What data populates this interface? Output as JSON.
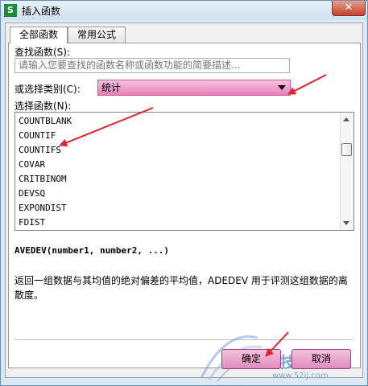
{
  "window": {
    "title": "插入函数",
    "app_icon": "S",
    "close": "✕"
  },
  "tabs": [
    {
      "label": "全部函数"
    },
    {
      "label": "常用公式"
    }
  ],
  "search": {
    "label": "查找函数(S):",
    "placeholder": "请输入您要查找的函数名称或函数功能的简要描述..."
  },
  "category": {
    "label": "或选择类别(C):",
    "value": "统计"
  },
  "function_list": {
    "label": "选择函数(N):",
    "items": [
      "COUNTBLANK",
      "COUNTIF",
      "COUNTIFS",
      "COVAR",
      "CRITBINOM",
      "DEVSQ",
      "EXPONDIST",
      "FDIST"
    ]
  },
  "details": {
    "signature": "AVEDEV(number1, number2, ...)",
    "description": "返回一组数据与其均值的绝对偏差的平均值，ADEDEV 用于评测这组数据的离散度。"
  },
  "buttons": {
    "ok": "确定",
    "cancel": "取消"
  },
  "colors": {
    "annotation_arrow": "#e5222b",
    "select_highlight": "#e77fb8"
  },
  "watermark": {
    "text": "IT技术",
    "url": "www.52ij.com"
  }
}
